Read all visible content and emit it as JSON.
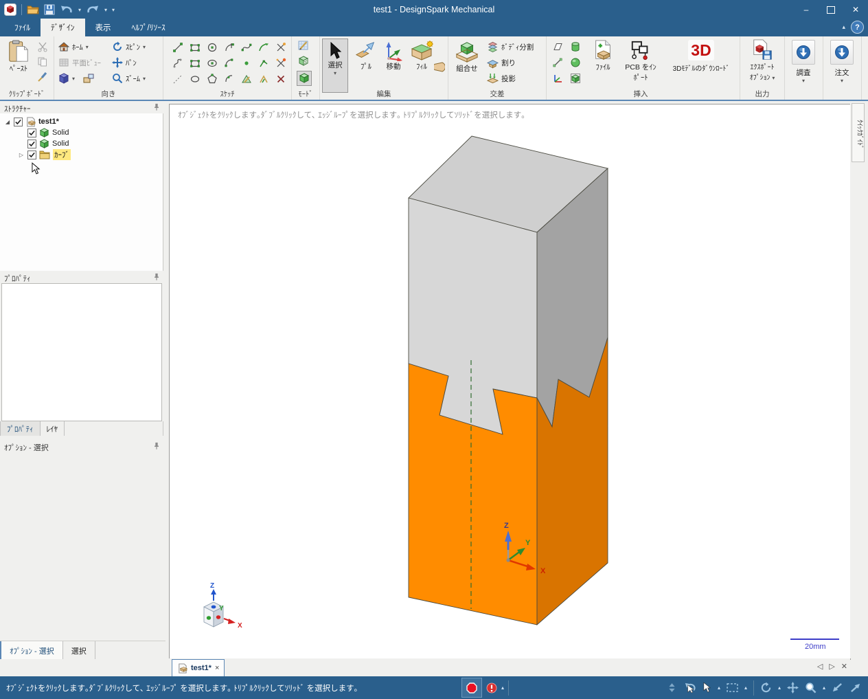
{
  "window": {
    "title": "test1 - DesignSpark Mechanical"
  },
  "titlebar_icons": [
    "app-logo",
    "open-folder",
    "save",
    "undo",
    "redo",
    "customize-quick-access"
  ],
  "menu_tabs": [
    {
      "label": "ﾌｧｲﾙ",
      "active": false
    },
    {
      "label": "ﾃﾞｻﾞｲﾝ",
      "active": true
    },
    {
      "label": "表示",
      "active": false
    },
    {
      "label": "ﾍﾙﾌﾟ/ﾘｿｰｽ",
      "active": false
    }
  ],
  "ribbon": {
    "clipboard": {
      "group_label": "ｸﾘｯﾌﾟﾎﾞｰﾄﾞ",
      "paste": "ﾍﾟｰｽﾄ"
    },
    "orientation": {
      "group_label": "向き",
      "home": "ﾎｰﾑ",
      "spin": "ｽﾋﾟﾝ",
      "plan_view": "平面ﾋﾞｭｰ",
      "pan": "ﾊﾟﾝ",
      "zoom": "ｽﾞｰﾑ"
    },
    "sketch": {
      "group_label": "ｽｹｯﾁ",
      "icons": [
        "line",
        "rectangle",
        "circle",
        "tangent-arc",
        "spline",
        "sweep-arc",
        "trim",
        "curve",
        "rounded-rectangle",
        "ellipse",
        "arc",
        "point",
        "bend",
        "split-curve",
        "construction-line",
        "filled-ellipse",
        "polygon",
        "three-point-arc",
        "sketch-plane",
        "offset-curve",
        "delete-curve"
      ]
    },
    "mode": {
      "group_label": "ﾓｰﾄﾞ",
      "icons": [
        "sketch-mode",
        "section-mode",
        "solid-mode"
      ],
      "selected": "solid-mode"
    },
    "edit": {
      "group_label": "編集",
      "select": "選択",
      "pull": "ﾌﾟﾙ",
      "move": "移動",
      "fill": "ﾌｨﾙ"
    },
    "intersect": {
      "group_label": "交差",
      "combine": "組合せ",
      "split_body": "ﾎﾞﾃﾞｨ分割",
      "split": "割り",
      "project": "投影"
    },
    "insert": {
      "group_label": "挿入",
      "file": "ﾌｧｲﾙ",
      "pcb_line1": "PCB をｲﾝ",
      "pcb_line2": "ﾎﾟｰﾄ",
      "download_3d": "3Dﾓﾃﾞﾙのﾀﾞｳﾝﾛｰﾄﾞ",
      "logo_3d": "3D",
      "small_icons": [
        "plane",
        "line-3d",
        "axes",
        "cylinder",
        "sphere",
        "shell"
      ]
    },
    "output": {
      "group_label": "出力",
      "export": "ｴｸｽﾎﾟｰﾄ",
      "options": "ｵﾌﾟｼｮﾝ"
    },
    "investigate": {
      "label": "調査"
    },
    "order": {
      "label": "注文"
    }
  },
  "structure": {
    "title": "ｽﾄﾗｸﾁｬｰ",
    "items": [
      {
        "label": "test1*",
        "type": "design",
        "checked": true,
        "expanded": true
      },
      {
        "label": "Solid",
        "type": "solid",
        "checked": true
      },
      {
        "label": "Solid",
        "type": "solid",
        "checked": true
      },
      {
        "label": "ｶｰﾌﾞ",
        "type": "curves-folder",
        "checked": true,
        "highlighted": true
      }
    ]
  },
  "properties": {
    "title": "ﾌﾟﾛﾊﾟﾃｨ",
    "tabs": [
      {
        "label": "ﾌﾟﾛﾊﾟﾃｨ",
        "active": true
      },
      {
        "label": "ﾚｲﾔ",
        "active": false
      }
    ]
  },
  "options_panel": {
    "title": "ｵﾌﾟｼｮﾝ - 選択"
  },
  "bottom_left_tabs": [
    {
      "label": "ｵﾌﾟｼｮﾝ - 選択",
      "active": true
    },
    {
      "label": "選択",
      "active": false
    }
  ],
  "doc_tab": {
    "label": "test1*"
  },
  "viewport": {
    "hint": "ｵﾌﾞｼﾞｪｸﾄをｸﾘｯｸします｡ﾀﾞﾌﾞﾙｸﾘｯｸして､ ｴｯｼﾞﾙｰﾌﾟを選択します｡ ﾄﾘﾌﾟﾙｸﾘｯｸしてｿﾘｯﾄﾞを選択します｡",
    "scale_label": "20mm",
    "quick_guide_tab": "ｸｲｯｸｶﾞｲﾄﾞ",
    "axis_labels": {
      "x": "X",
      "y": "Y",
      "z": "Z"
    }
  },
  "status_bar": {
    "message": "ｵﾌﾞｼﾞｪｸﾄをｸﾘｯｸします｡ﾀﾞﾌﾞﾙｸﾘｯｸして､ ｴｯｼﾞﾙｰﾌﾟ を選択します｡ ﾄﾘﾌﾟﾙｸﾘｯｸしてｿﾘｯﾄﾞ を選択します｡"
  },
  "icons": {
    "minimize": "–",
    "close": "✕",
    "help": "?",
    "dropdown": "▾",
    "dropdown_up": "▴",
    "collapse_ribbon": "▴",
    "expanded_node": "◢",
    "collapsed_node": "▷",
    "tab_scroll_left": "◁",
    "tab_scroll_right": "▷",
    "tab_close": "✕",
    "doc_tab_close": "×"
  },
  "colors": {
    "titlebar": "#2a5f8c",
    "ribbon_bg": "#f0f0ee",
    "accent_border": "#5b87b5",
    "tree_highlight": "#ffe87f",
    "model_gray_front": "#d7d7d7",
    "model_gray_side": "#a3a3a3",
    "model_gray_top": "#cfcfcf",
    "model_orange_front": "#ff8c00",
    "model_orange_side": "#d97400",
    "scale_blue": "#3d3dc8",
    "status_icon_blue": "#9cc3e0"
  }
}
